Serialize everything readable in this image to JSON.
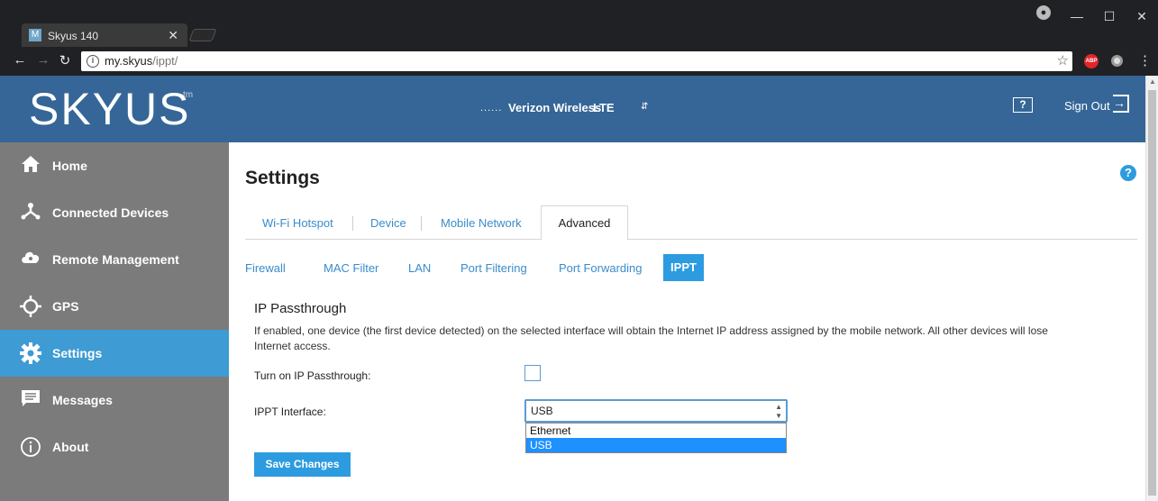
{
  "browser": {
    "tab_title": "Skyus 140",
    "tab_favicon": "M",
    "url_host": "my.skyus",
    "url_path": "/ippt/",
    "ext_abp": "ABP"
  },
  "header": {
    "logo": "SKYUS",
    "logo_tm": "tm",
    "signal": "......",
    "carrier": "Verizon Wireless",
    "network_type": "LTE",
    "help": "?",
    "signout": "Sign Out"
  },
  "sidebar": {
    "items": [
      {
        "label": "Home",
        "icon": "home-icon"
      },
      {
        "label": "Connected Devices",
        "icon": "connected-devices-icon"
      },
      {
        "label": "Remote Management",
        "icon": "cloud-icon"
      },
      {
        "label": "GPS",
        "icon": "gps-icon"
      },
      {
        "label": "Settings",
        "icon": "gear-icon",
        "active": true
      },
      {
        "label": "Messages",
        "icon": "message-icon"
      },
      {
        "label": "About",
        "icon": "info-icon"
      }
    ]
  },
  "main": {
    "title": "Settings",
    "help": "?",
    "tabs": [
      "Wi-Fi Hotspot",
      "Device",
      "Mobile Network",
      "Advanced"
    ],
    "active_tab": "Advanced",
    "subtabs": [
      "Firewall",
      "MAC Filter",
      "LAN",
      "Port Filtering",
      "Port Forwarding",
      "IPPT"
    ],
    "active_subtab": "IPPT",
    "section_title": "IP Passthrough",
    "description": "If enabled, one device (the first device detected) on the selected interface will obtain the Internet IP address assigned by the mobile network. All other devices will lose Internet access.",
    "passthrough_label": "Turn on IP Passthrough:",
    "passthrough_checked": false,
    "interface_label": "IPPT Interface:",
    "interface_value": "USB",
    "interface_options": [
      "Ethernet",
      "USB"
    ],
    "save_label": "Save Changes"
  },
  "colors": {
    "header_bg": "#356697",
    "sidebar_bg": "#7b7b7b",
    "accent": "#2d9be0",
    "link": "#3a8ccb"
  }
}
